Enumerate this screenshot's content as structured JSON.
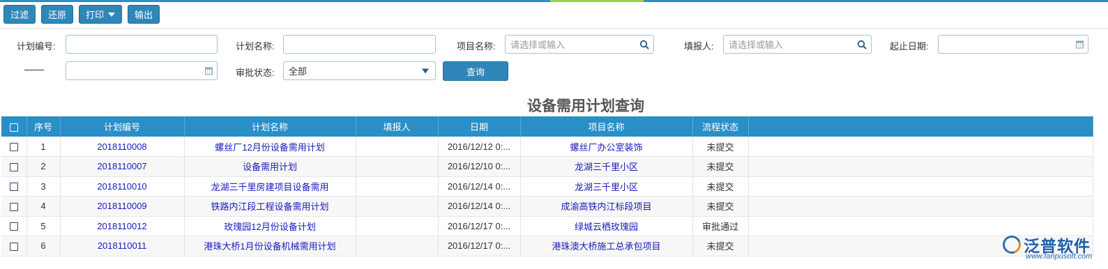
{
  "toolbar": {
    "filter": "过滤",
    "restore": "还原",
    "print": "打印",
    "export": "输出"
  },
  "filters": {
    "plan_no_label": "计划编号:",
    "plan_name_label": "计划名称:",
    "project_name_label": "项目名称:",
    "project_name_placeholder": "请选择或输入",
    "filler_label": "填报人:",
    "filler_placeholder": "请选择或输入",
    "date_range_label": "起止日期:",
    "approval_status_label": "审批状态:",
    "approval_status_value": "全部",
    "query_button": "查询"
  },
  "page_title": "设备需用计划查询",
  "table": {
    "columns": [
      "序号",
      "计划编号",
      "计划名称",
      "填报人",
      "日期",
      "项目名称",
      "流程状态"
    ],
    "rows": [
      {
        "idx": "1",
        "plan_no": "2018110008",
        "plan_name": "螺丝厂12月份设备需用计划",
        "filler": "",
        "date": "2016/12/12 0:...",
        "project": "螺丝厂办公室装饰",
        "status": "未提交"
      },
      {
        "idx": "2",
        "plan_no": "2018110007",
        "plan_name": "设备需用计划",
        "filler": "",
        "date": "2016/12/10 0:...",
        "project": "龙湖三千里小区",
        "status": "未提交"
      },
      {
        "idx": "3",
        "plan_no": "2018110010",
        "plan_name": "龙湖三千里房建项目设备需用",
        "filler": "",
        "date": "2016/12/14 0:...",
        "project": "龙湖三千里小区",
        "status": "未提交"
      },
      {
        "idx": "4",
        "plan_no": "2018110009",
        "plan_name": "铁路内江段工程设备需用计划",
        "filler": "",
        "date": "2016/12/14 0:...",
        "project": "成渝高铁内江标段项目",
        "status": "未提交"
      },
      {
        "idx": "5",
        "plan_no": "2018110012",
        "plan_name": "玫瑰园12月份设备计划",
        "filler": "",
        "date": "2016/12/17 0:...",
        "project": "绿城云栖玫瑰园",
        "status": "审批通过"
      },
      {
        "idx": "6",
        "plan_no": "2018110011",
        "plan_name": "港珠大桥1月份设备机械需用计划",
        "filler": "",
        "date": "2016/12/17 0:...",
        "project": "港珠澳大桥施工总承包项目",
        "status": "未提交"
      }
    ]
  },
  "watermark": {
    "brand": "泛普软件",
    "url": "www.fanpusoft.com"
  },
  "colors": {
    "accent": "#2a8ec7",
    "link": "#1a1ab8"
  }
}
